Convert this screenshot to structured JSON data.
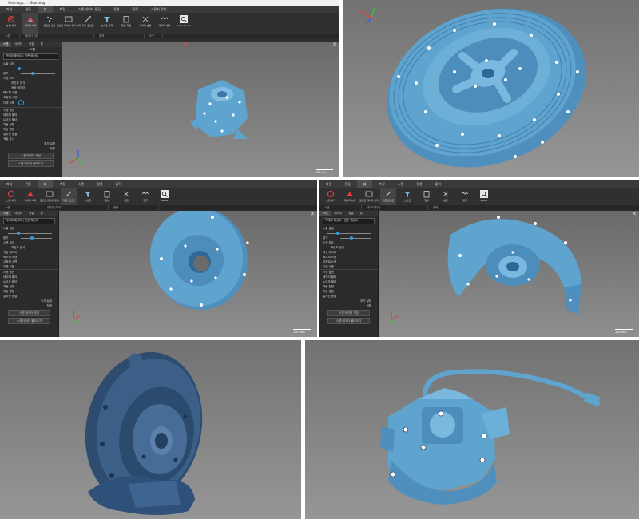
{
  "top_left": {
    "window_title": "Geomagic... - Scanning",
    "tabs": [
      {
        "label": "파일"
      },
      {
        "label": "편집"
      },
      {
        "label": "뷰"
      },
      {
        "label": "측정"
      },
      {
        "label": "스캔 데이터 편집"
      },
      {
        "label": "정렬"
      },
      {
        "label": "출력"
      },
      {
        "label": "사용자 정의"
      }
    ],
    "tools": [
      {
        "label": "스캔 하기"
      },
      {
        "label": "데이터 처리"
      },
      {
        "label": "포인트 인식"
      },
      {
        "label": "포인트 데이터 관리 처리"
      },
      {
        "label": "기준 포인트"
      },
      {
        "label": "노이즈 제거"
      },
      {
        "label": "형상 지정"
      },
      {
        "label": "데이터 병합"
      },
      {
        "label": "데이터 정렬"
      },
      {
        "label": "Scan Assist"
      }
    ],
    "groups": [
      {
        "label": "스캔"
      },
      {
        "label": "데이터 처리"
      },
      {
        "label": "출력"
      },
      {
        "label": "도구"
      }
    ],
    "panel": {
      "tabs": [
        {
          "label": "스캔"
        },
        {
          "label": "데이터"
        },
        {
          "label": "정렬"
        },
        {
          "label": "뷰"
        }
      ],
      "section": "스캔",
      "dropdown": "카메라 해상도 | 표준 해상도",
      "row_exposure": "노출 설정",
      "row_brightness": "밝기",
      "row_mode": "스캔 모드",
      "opts": [
        {
          "label": "포인트 인식"
        },
        {
          "label": "색상 데이터"
        },
        {
          "label": "텍스처 스캔"
        },
        {
          "label": "고정밀 스캔"
        },
        {
          "label": "타겟 사용"
        }
      ],
      "section2": "스캔 옵션",
      "checks": [
        {
          "label": "데이터 필터"
        },
        {
          "label": "노이즈 필터"
        },
        {
          "label": "자동 정렬"
        },
        {
          "label": "자동 병합"
        },
        {
          "label": "실시간 정렬"
        },
        {
          "label": "색상 표시"
        }
      ],
      "more_label": "추가 설정",
      "apply_label": "적용",
      "btn1": "스캔 데이터 저장",
      "btn2": "스캔 데이터 불러오기"
    },
    "scale": "100 mm"
  },
  "mid_left": {
    "tabs": [
      {
        "label": "파일"
      },
      {
        "label": "편집"
      },
      {
        "label": "뷰"
      },
      {
        "label": "측정"
      },
      {
        "label": "스캔"
      },
      {
        "label": "정렬"
      },
      {
        "label": "출력"
      }
    ],
    "tools": [
      {
        "label": "스캔 하기"
      },
      {
        "label": "데이터 처리"
      },
      {
        "label": "포인트 데이터 관리"
      },
      {
        "label": "기준 포인트"
      },
      {
        "label": "노이즈"
      },
      {
        "label": "형상"
      },
      {
        "label": "병합"
      },
      {
        "label": "정렬"
      },
      {
        "label": "Assist"
      }
    ],
    "groups": [
      {
        "label": "스캔"
      },
      {
        "label": "데이터 처리"
      },
      {
        "label": "출력"
      }
    ],
    "scale": "100 mm"
  },
  "mid_right": {
    "tabs": [
      {
        "label": "파일"
      },
      {
        "label": "편집"
      },
      {
        "label": "뷰"
      },
      {
        "label": "측정"
      },
      {
        "label": "스캔"
      },
      {
        "label": "정렬"
      },
      {
        "label": "출력"
      }
    ],
    "tools": [
      {
        "label": "스캔 하기"
      },
      {
        "label": "데이터 처리"
      },
      {
        "label": "포인트 데이터 관리"
      },
      {
        "label": "기준 포인트"
      },
      {
        "label": "노이즈"
      },
      {
        "label": "형상"
      },
      {
        "label": "병합"
      },
      {
        "label": "정렬"
      },
      {
        "label": "Assist"
      }
    ],
    "groups": [
      {
        "label": "스캔"
      },
      {
        "label": "데이터 처리"
      },
      {
        "label": "출력"
      }
    ],
    "scale": "100 mm"
  },
  "colors": {
    "scan_blue": "#5fa3cf",
    "dark_blue": "#3b5f87",
    "viewport": "#7a7a7a",
    "ribbon": "#303030"
  }
}
